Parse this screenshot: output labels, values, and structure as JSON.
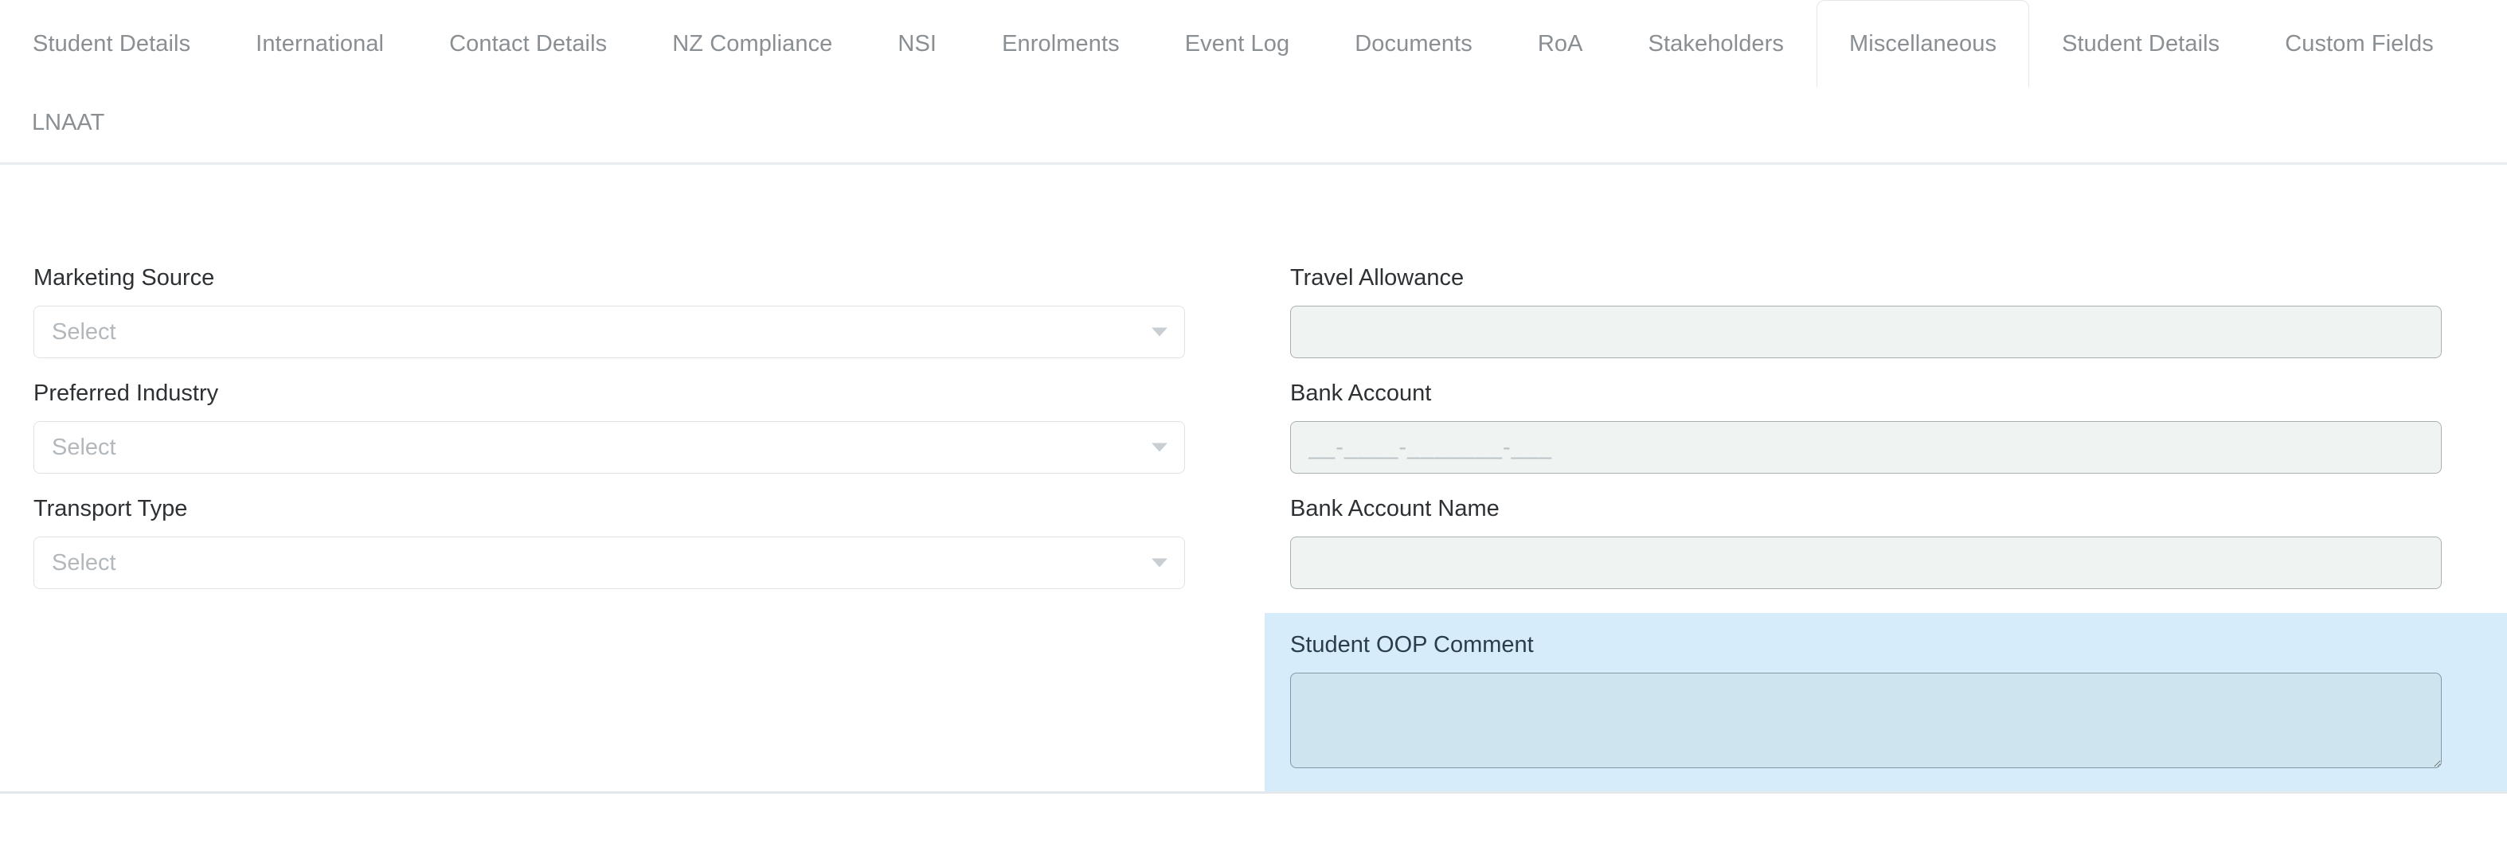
{
  "tabs": {
    "primary": [
      {
        "label": "Student Details",
        "active": false
      },
      {
        "label": "International",
        "active": false
      },
      {
        "label": "Contact Details",
        "active": false
      },
      {
        "label": "NZ Compliance",
        "active": false
      },
      {
        "label": "NSI",
        "active": false
      },
      {
        "label": "Enrolments",
        "active": false
      },
      {
        "label": "Event Log",
        "active": false
      },
      {
        "label": "Documents",
        "active": false
      },
      {
        "label": "RoA",
        "active": false
      },
      {
        "label": "Stakeholders",
        "active": false
      },
      {
        "label": "Miscellaneous",
        "active": true
      },
      {
        "label": "Student Details",
        "active": false
      },
      {
        "label": "Custom Fields",
        "active": false
      }
    ],
    "secondary": [
      {
        "label": "LNAAT",
        "active": false
      }
    ]
  },
  "form": {
    "left_column": [
      {
        "label": "Marketing Source",
        "type": "select",
        "value": "",
        "placeholder": "Select",
        "icon": "chevron-down-icon"
      },
      {
        "label": "Preferred Industry",
        "type": "select",
        "value": "",
        "placeholder": "Select",
        "icon": "chevron-down-icon"
      },
      {
        "label": "Transport Type",
        "type": "select",
        "value": "",
        "placeholder": "Select",
        "icon": "chevron-down-icon"
      }
    ],
    "right_column": [
      {
        "label": "Travel Allowance",
        "type": "text",
        "value": "",
        "placeholder": ""
      },
      {
        "label": "Bank Account",
        "type": "text",
        "value": "",
        "placeholder": "__-____-_______-___"
      },
      {
        "label": "Bank Account Name",
        "type": "text",
        "value": "",
        "placeholder": ""
      }
    ],
    "highlighted_field": {
      "label": "Student OOP Comment",
      "type": "textarea",
      "value": "",
      "placeholder": ""
    }
  },
  "colors": {
    "page_background": "#ffffff",
    "tab_text": "#8a8f94",
    "active_tab_border": "#e3e6ea",
    "label_text": "#2d3134",
    "select_border": "#dfe3e6",
    "select_placeholder": "#b3b8bc",
    "input_background": "#eff4f3",
    "input_border": "#a9b0b3",
    "highlight_background": "#d6ecfa",
    "highlight_input_background": "#cee5f0",
    "highlight_input_border": "#7d9aa6",
    "divider": "#e9edf1"
  }
}
